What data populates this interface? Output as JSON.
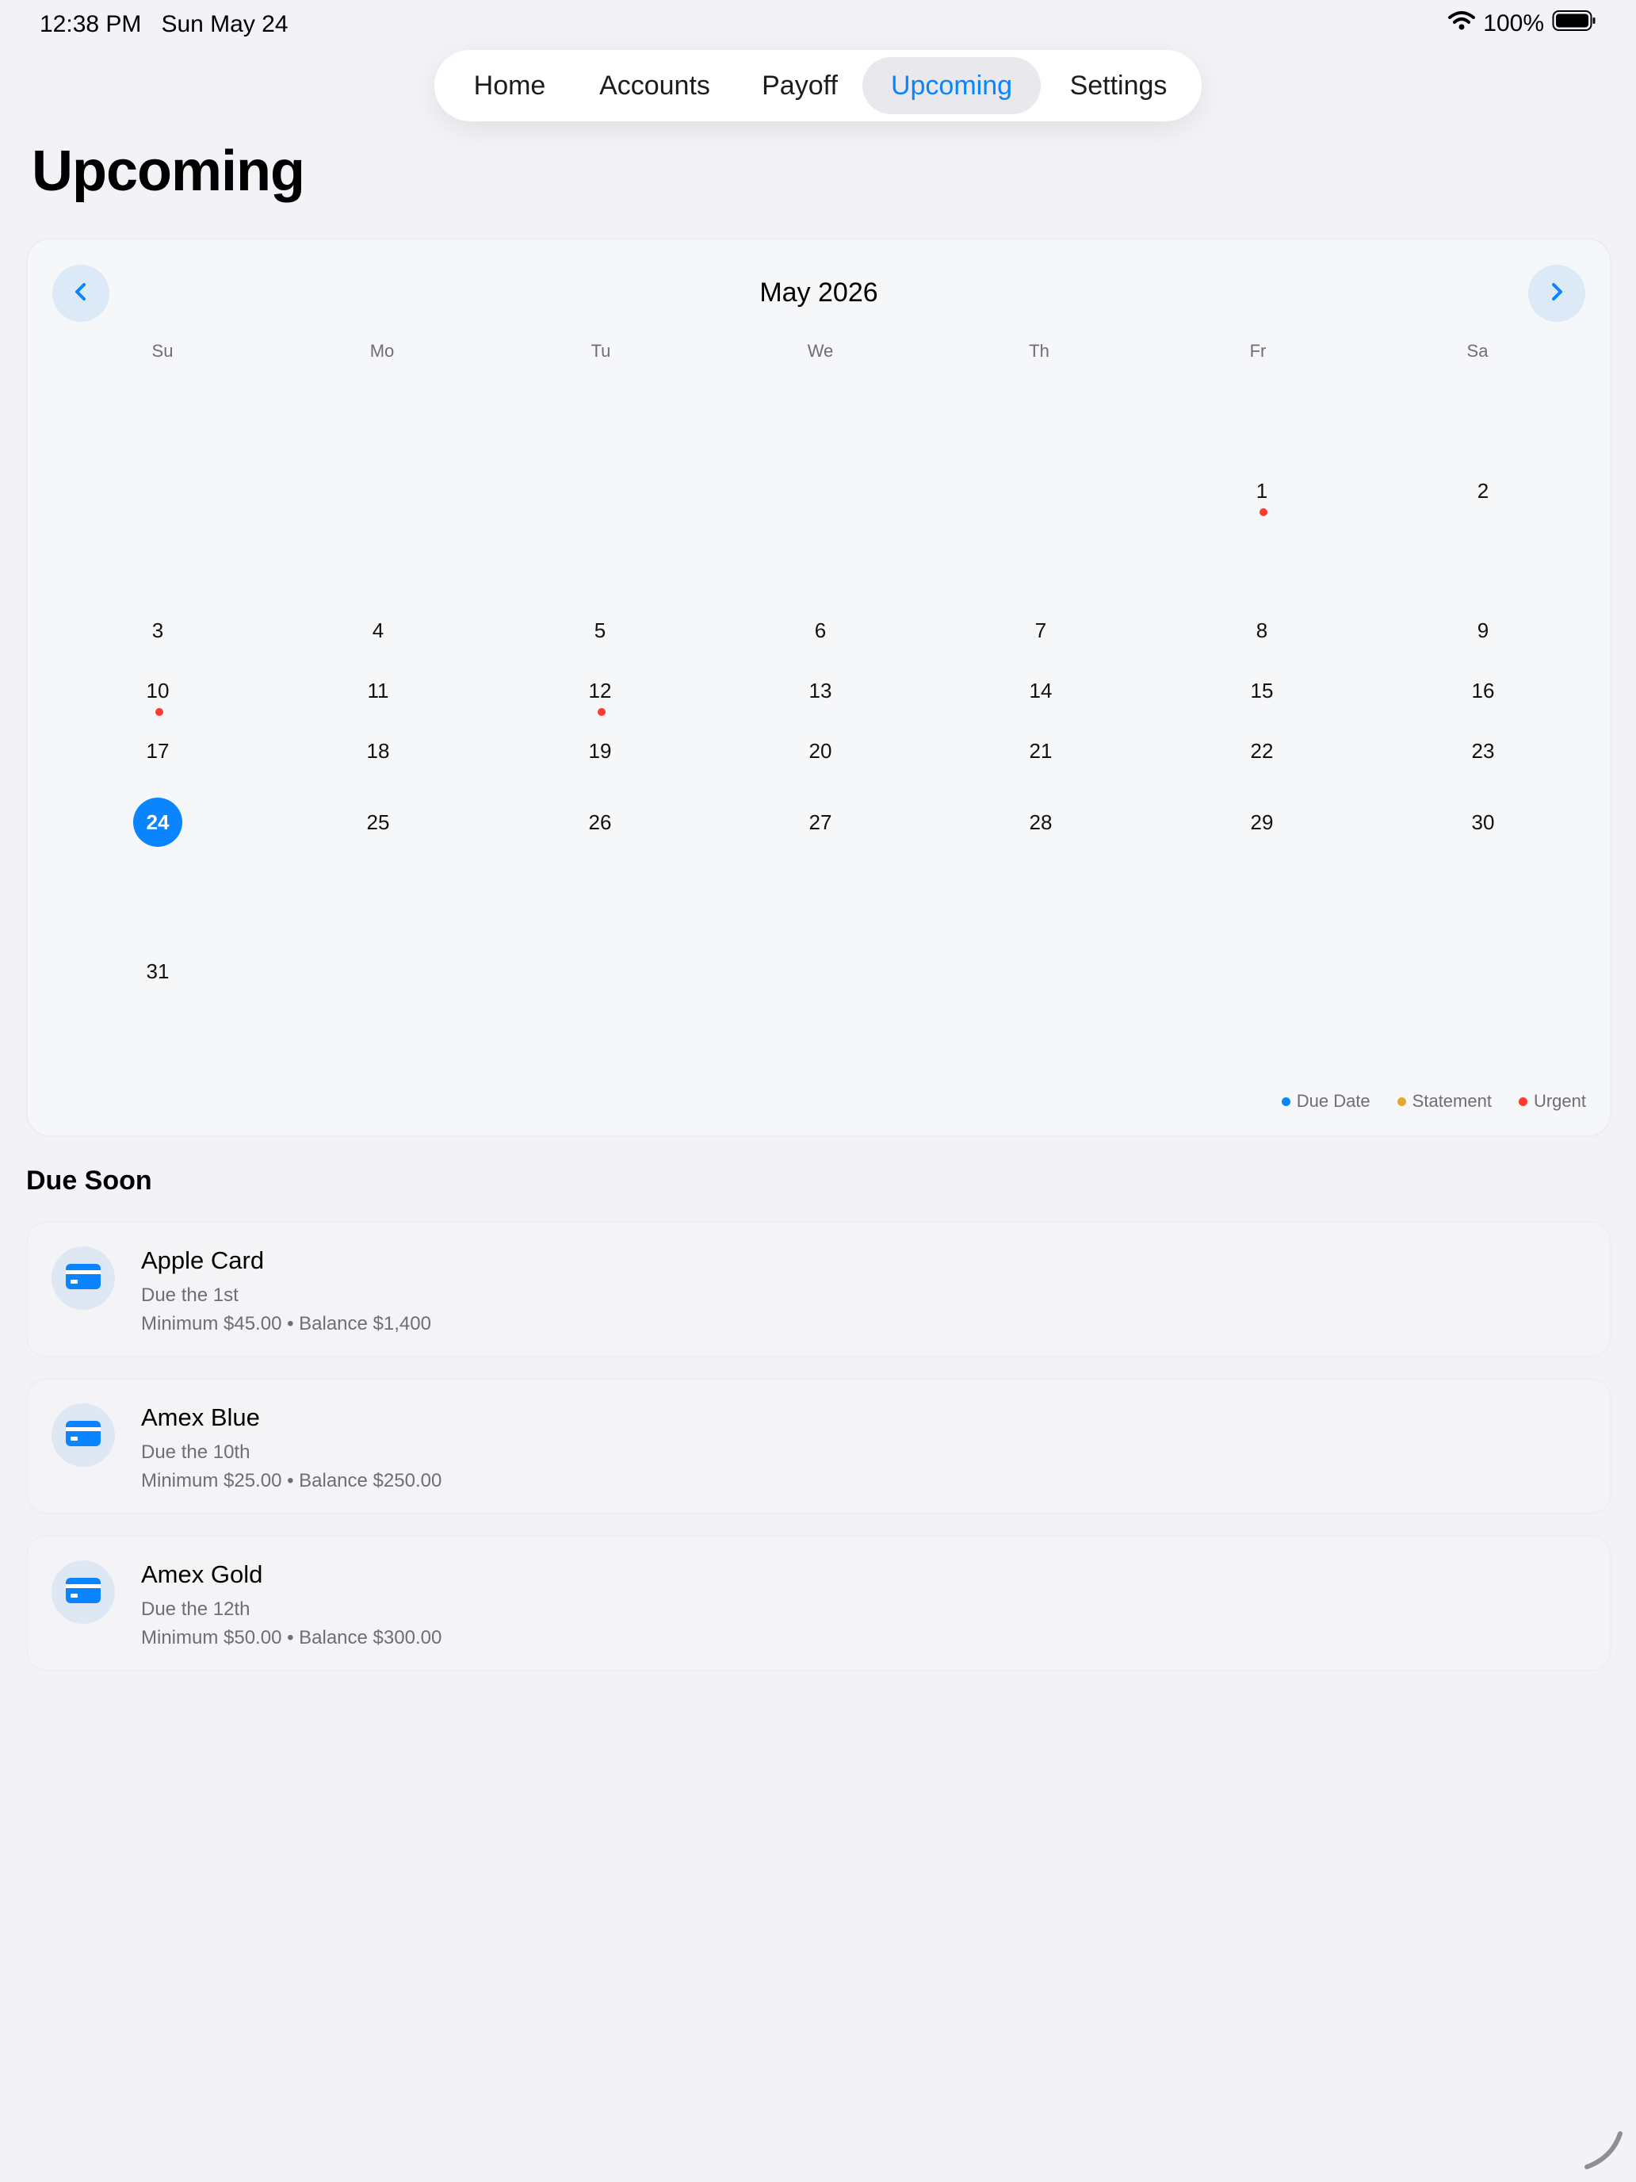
{
  "status_bar": {
    "time": "12:38 PM",
    "date": "Sun May 24",
    "battery": "100%"
  },
  "tabs": [
    {
      "label": "Home",
      "active": false
    },
    {
      "label": "Accounts",
      "active": false
    },
    {
      "label": "Payoff",
      "active": false
    },
    {
      "label": "Upcoming",
      "active": true
    },
    {
      "label": "Settings",
      "active": false
    }
  ],
  "page_title": "Upcoming",
  "calendar": {
    "month_label": "May 2026",
    "weekdays": [
      "Su",
      "Mo",
      "Tu",
      "We",
      "Th",
      "Fr",
      "Sa"
    ],
    "today": "24",
    "urgent_days": [
      "1",
      "10",
      "12"
    ],
    "weeks": [
      [
        "",
        "",
        "",
        "",
        "",
        "1",
        "2"
      ],
      [
        "3",
        "4",
        "5",
        "6",
        "7",
        "8",
        "9"
      ],
      [
        "10",
        "11",
        "12",
        "13",
        "14",
        "15",
        "16"
      ],
      [
        "17",
        "18",
        "19",
        "20",
        "21",
        "22",
        "23"
      ],
      [
        "24",
        "25",
        "26",
        "27",
        "28",
        "29",
        "30"
      ],
      [
        "31",
        "",
        "",
        "",
        "",
        "",
        ""
      ]
    ],
    "legend": [
      {
        "label": "Due Date",
        "color": "#0a84ff"
      },
      {
        "label": "Statement",
        "color": "#e0a82e"
      },
      {
        "label": "Urgent",
        "color": "#ff3b30"
      }
    ]
  },
  "due_soon": {
    "title": "Due Soon",
    "items": [
      {
        "name": "Apple Card",
        "due": "Due the 1st",
        "meta": "Minimum $45.00 • Balance $1,400",
        "icon": "credit-card-icon"
      },
      {
        "name": "Amex Blue",
        "due": "Due the 10th",
        "meta": "Minimum $25.00 • Balance $250.00",
        "icon": "credit-card-icon"
      },
      {
        "name": "Amex Gold",
        "due": "Due the 12th",
        "meta": "Minimum $50.00 • Balance $300.00",
        "icon": "credit-card-icon"
      }
    ]
  },
  "colors": {
    "accent": "#0a84ff",
    "urgent": "#ff3b30",
    "statement": "#e0a82e"
  }
}
